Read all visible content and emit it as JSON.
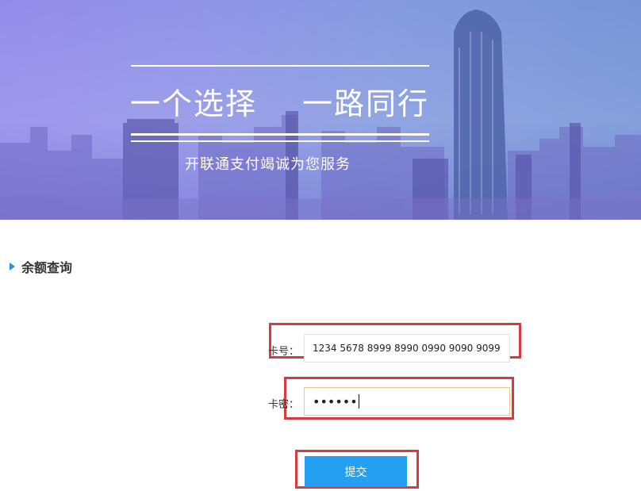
{
  "banner": {
    "slogan_left": "一个选择",
    "slogan_right": "一路同行",
    "subtitle": "开联通支付竭诚为您服务"
  },
  "section": {
    "title": "余额查询"
  },
  "form": {
    "card_label": "卡号：",
    "card_value": "1234 5678 8999 8990 0990 9090 9099",
    "password_label": "卡密：",
    "password_value": "••••••",
    "submit_label": "提交"
  },
  "colors": {
    "accent": "#23a0f2",
    "highlight": "#d9393f",
    "section_marker": "#2b8fd8"
  }
}
